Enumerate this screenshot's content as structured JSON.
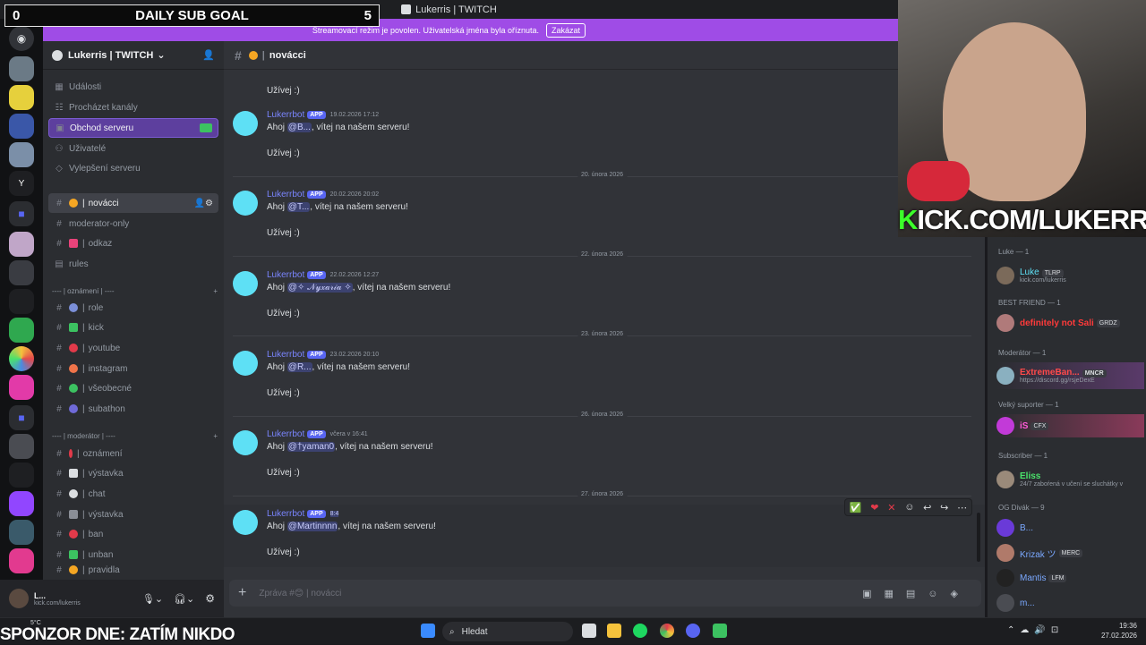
{
  "window": {
    "title": "Lukerris | TWITCH"
  },
  "banner": {
    "text": "Streamovací režim je povolen. Uživatelská jména byla oříznuta.",
    "button": "Zakázat"
  },
  "goal": {
    "left": "0",
    "title": "DAILY SUB GOAL",
    "right": "5"
  },
  "server": {
    "name": "Lukerris | TWITCH"
  },
  "sidebar": {
    "events": "Události",
    "browse": "Procházet kanály",
    "shop": "Obchod serveru",
    "users": "Uživatelé",
    "boost": "Vylepšení serveru",
    "channels_top": [
      "novácci",
      "moderator-only",
      "odkaz",
      "rules"
    ],
    "cat1": "---- | oznámení | ----",
    "cat1_channels": [
      "role",
      "kick",
      "youtube",
      "instagram",
      "všeobecné",
      "subathon"
    ],
    "cat2": "---- | moderátor | ----",
    "cat2_channels": [
      "oznámení",
      "výstavka",
      "chat",
      "výstavka",
      "ban",
      "unban",
      "pravidla"
    ]
  },
  "user": {
    "name": "L...",
    "sub": "kick.com/lukerris"
  },
  "chat": {
    "channel": "novácci",
    "messages": [
      {
        "line1_pre": "",
        "mention": "",
        "line1_post": "",
        "line2": "Užívej :)"
      },
      {
        "author": "Lukerrbot",
        "app": "APP",
        "time": "19.02.2026 17:12",
        "pre": "Ahoj ",
        "mention": "@B...",
        "post": ", vítej na našem serveru!",
        "line2": "Užívej :)"
      },
      {
        "author": "Lukerrbot",
        "app": "APP",
        "time": "20.02.2026 20:02",
        "pre": "Ahoj ",
        "mention": "@T...",
        "post": ", vítej na našem serveru!",
        "line2": "Užívej :)"
      },
      {
        "author": "Lukerrbot",
        "app": "APP",
        "time": "22.02.2026 12:27",
        "pre": "Ahoj ",
        "mention": "@✧ 𝒩𝓎𝓍𝒶𝓇𝒾𝒶 ✧",
        "post": ", vítej na našem serveru!",
        "line2": "Užívej :)"
      },
      {
        "author": "Lukerrbot",
        "app": "APP",
        "time": "23.02.2026 20:10",
        "pre": "Ahoj ",
        "mention": "@R...",
        "post": ", vítej na našem serveru!",
        "line2": "Užívej :)"
      },
      {
        "author": "Lukerrbot",
        "app": "APP",
        "time": "včera v 16:41",
        "pre": "Ahoj ",
        "mention": "@†yaman0",
        "post": ", vítej na našem serveru!",
        "line2": "Užívej :)"
      },
      {
        "author": "Lukerrbot",
        "app": "APP",
        "time": "8:4",
        "pre": "Ahoj ",
        "mention": "@Martinnnn",
        "post": ", vítej na našem serveru!",
        "line2": "Užívej :)"
      }
    ],
    "dividers": [
      "20. února 2026",
      "22. února 2026",
      "23. února 2026",
      "26. února 2026",
      "27. února 2026"
    ],
    "input_placeholder": "Zpráva #😊 | novácci"
  },
  "members": {
    "groups": [
      "Luke — 1",
      "BEST FRIEND — 1",
      "Moderátor — 1",
      "Velký suporter — 1",
      "Subscriber — 1",
      "OG Divák — 9"
    ],
    "luke": {
      "name": "Luke",
      "badge": "TLRP",
      "sub": "kick.com/lukerris"
    },
    "bf": {
      "name": "definitely not Sali",
      "badge": "GRDZ"
    },
    "mod": {
      "name": "ExtremeBan...",
      "badge": "MNCR",
      "sub": "https://discord.gg/rsjeDexE"
    },
    "vs": {
      "name": "iS",
      "badge": "CFX"
    },
    "subr": {
      "name": "Eliss",
      "sub": "24/7 zaboŕená v učení se sluchátky v"
    },
    "og": [
      {
        "name": "B..."
      },
      {
        "name": "Krizak ツ",
        "badge": "MERC"
      },
      {
        "name": "Mantis",
        "badge": "LFM"
      },
      {
        "name": "m..."
      }
    ]
  },
  "overlay": {
    "kick": "KICK.COM/LUKERRIS",
    "sponsor": "SPONZOR DNE: ZATÍM NIKDO"
  },
  "taskbar": {
    "search": "Hledat",
    "weather": "5°C",
    "time": "19:36",
    "date": "27.02.2026"
  }
}
